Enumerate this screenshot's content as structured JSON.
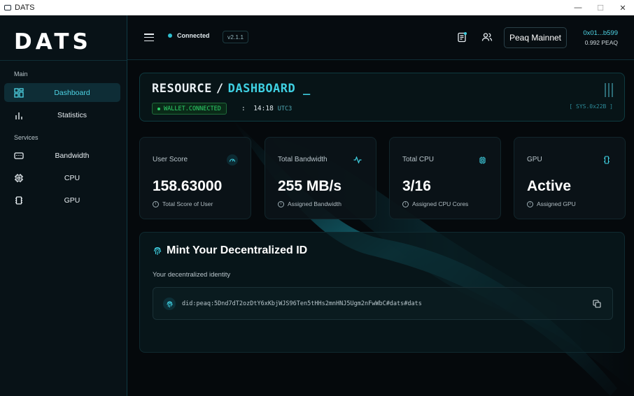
{
  "window": {
    "title": "DATS",
    "controls": {
      "minimize": "—",
      "maximize": "☐",
      "close": "✕"
    }
  },
  "sidebar": {
    "logo": "DATS",
    "sections": [
      {
        "label": "Main",
        "items": [
          {
            "label": "Dashboard",
            "icon": "dashboard-icon",
            "active": true
          },
          {
            "label": "Statistics",
            "icon": "bar-chart-icon",
            "active": false
          }
        ]
      },
      {
        "label": "Services",
        "items": [
          {
            "label": "Bandwidth",
            "icon": "router-icon",
            "active": false
          },
          {
            "label": "CPU",
            "icon": "cpu-icon",
            "active": false
          },
          {
            "label": "GPU",
            "icon": "gpu-icon",
            "active": false
          }
        ]
      }
    ]
  },
  "header": {
    "status": "Connected",
    "version": "v2.1.1",
    "network": "Peaq Mainnet",
    "wallet_address": "0x01...b599",
    "wallet_balance": "0.992 PEAQ"
  },
  "resource": {
    "title_left": "RESOURCE",
    "separator": "/",
    "title_right": "DASHBOARD",
    "cursor": "_",
    "badge": "WALLET.CONNECTED",
    "time_sep": ":",
    "time": "14:18",
    "timezone": "UTC3",
    "sys_tag": "[ SYS.0x22B ]"
  },
  "stats": [
    {
      "label": "User Score",
      "value": "158.63000",
      "sub": "Total Score of User",
      "icon": "gauge-icon"
    },
    {
      "label": "Total Bandwidth",
      "value": "255 MB/s",
      "sub": "Assigned Bandwidth",
      "icon": "activity-icon"
    },
    {
      "label": "Total CPU",
      "value": "3/16",
      "sub": "Assigned CPU Cores",
      "icon": "cpu-icon"
    },
    {
      "label": "GPU",
      "value": "Active",
      "sub": "Assigned GPU",
      "icon": "gpu-icon"
    }
  ],
  "mint": {
    "title": "Mint Your Decentralized ID",
    "subtitle": "Your decentralized identity",
    "did": "did:peaq:5Dnd7dT2ozDtY6xKbjWJS96Ten5tHHs2mnHNJ5Ugm2nFwWbC#dats#dats"
  },
  "colors": {
    "accent": "#3fd0e2",
    "success": "#2ed36a",
    "background": "#05090c"
  }
}
